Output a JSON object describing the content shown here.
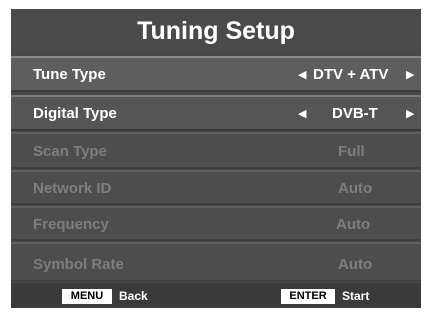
{
  "title": "Tuning Setup",
  "items": [
    {
      "label": "Tune Type",
      "value": "DTV + ATV",
      "left_arrow": "◀",
      "right_arrow": "▶"
    },
    {
      "label": "Digital Type",
      "value": "DVB-T",
      "left_arrow": "◀",
      "right_arrow": "▶"
    },
    {
      "label": "Scan Type",
      "value": "Full"
    },
    {
      "label": "Network ID",
      "value": "Auto"
    },
    {
      "label": "Frequency",
      "value": "Auto"
    },
    {
      "label": "Symbol Rate",
      "value": "Auto"
    }
  ],
  "footer": {
    "menu_key": "MENU",
    "menu_label": "Back",
    "enter_key": "ENTER",
    "enter_label": "Start"
  }
}
